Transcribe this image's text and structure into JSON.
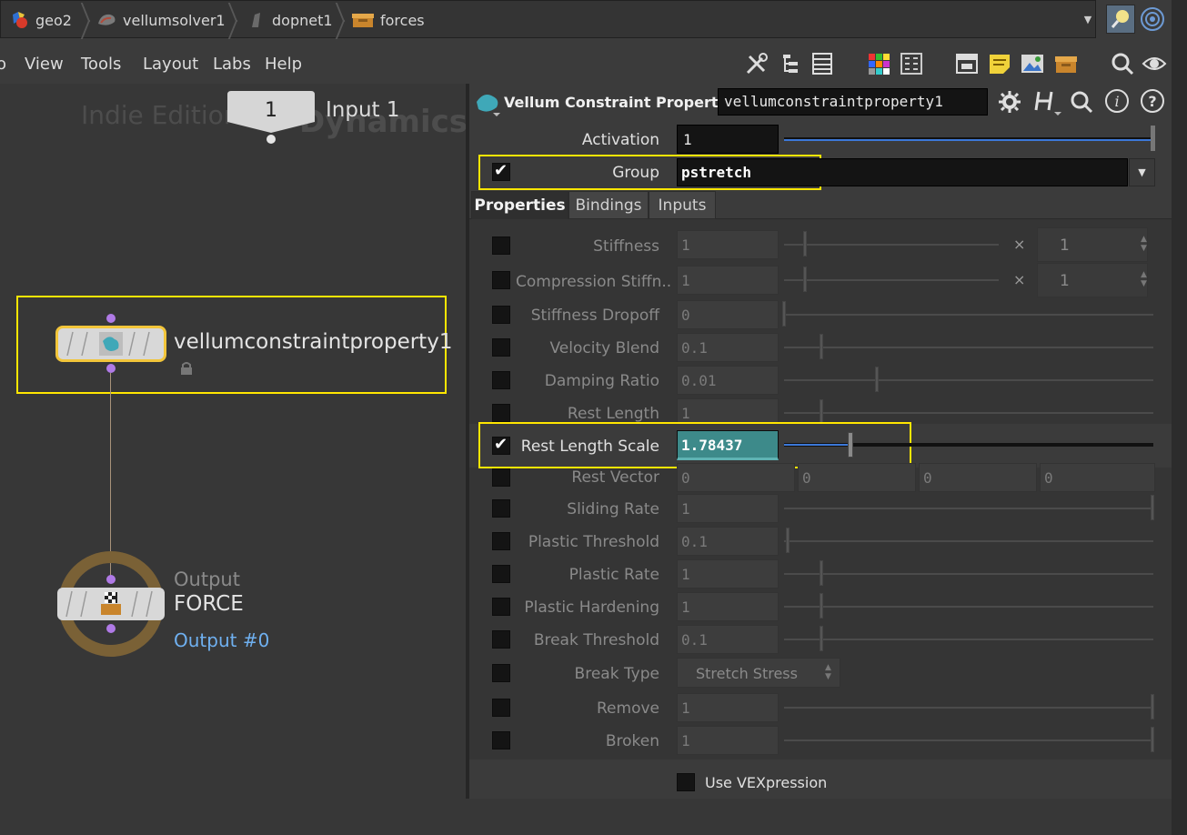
{
  "breadcrumbs": [
    {
      "label": "geo2",
      "icon": "geometry-object-icon"
    },
    {
      "label": "vellumsolver1",
      "icon": "vellum-solver-icon"
    },
    {
      "label": "dopnet1",
      "icon": "dop-network-icon"
    },
    {
      "label": "forces",
      "icon": "forces-box-icon"
    }
  ],
  "menu": [
    "View",
    "Tools",
    "Layout",
    "Labs",
    "Help"
  ],
  "menu_partial": "o",
  "network": {
    "watermark_left": "Indie Edition",
    "watermark_right": "Dynamics",
    "input_number": "1",
    "input_label": "Input 1",
    "node_name": "vellumconstraintproperty1",
    "output_label": "Output",
    "output_name": "FORCE",
    "output_link": "Output #0",
    "colors": {
      "highlight": "#ffe600",
      "connector": "#b07ae6",
      "output_ring": "#7a6136",
      "link": "#6fb0f0"
    }
  },
  "params": {
    "node_type": "Vellum Constraint Properties",
    "node_name": "vellumconstraintproperty1",
    "activation": {
      "label": "Activation",
      "value": "1"
    },
    "group": {
      "label": "Group",
      "value": "pstretch"
    },
    "tabs": [
      "Properties",
      "Bindings",
      "Inputs"
    ],
    "rows": [
      {
        "label": "Stiffness",
        "value": "1",
        "mult": "1"
      },
      {
        "label": "Compression Stiffn...",
        "value": "1",
        "mult": "1"
      },
      {
        "label": "Stiffness Dropoff",
        "value": "0"
      },
      {
        "label": "Velocity Blend",
        "value": "0.1"
      },
      {
        "label": "Damping Ratio",
        "value": "0.01"
      },
      {
        "label": "Rest Length",
        "value": "1"
      },
      {
        "label": "Rest Length Scale",
        "value": "1.78437"
      },
      {
        "label": "Rest Vector",
        "values": [
          "0",
          "0",
          "0",
          "0"
        ]
      },
      {
        "label": "Sliding Rate",
        "value": "1"
      },
      {
        "label": "Plastic Threshold",
        "value": "0.1"
      },
      {
        "label": "Plastic Rate",
        "value": "1"
      },
      {
        "label": "Plastic Hardening",
        "value": "1"
      },
      {
        "label": "Break Threshold",
        "value": "0.1"
      },
      {
        "label": "Break Type",
        "value": "Stretch Stress"
      },
      {
        "label": "Remove",
        "value": "1"
      },
      {
        "label": "Broken",
        "value": "1"
      }
    ],
    "mult_symbol": "×",
    "use_vex": "Use VEXpression",
    "rest_length_scale_fraction": 0.18
  }
}
